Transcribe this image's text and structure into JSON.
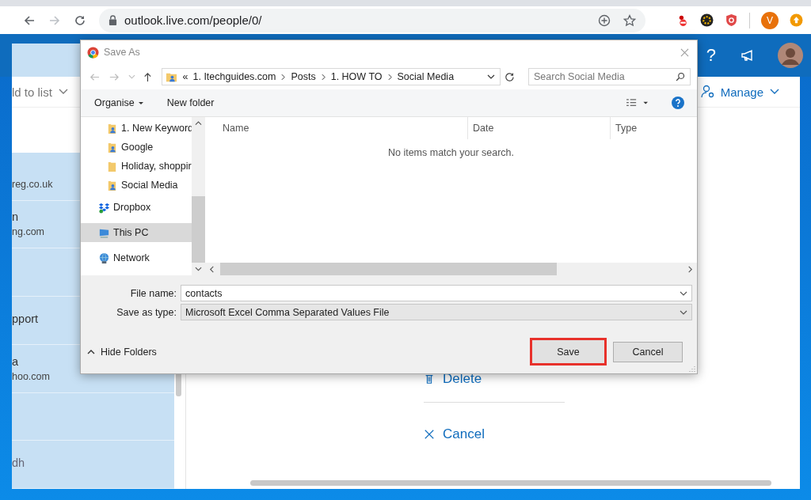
{
  "browser": {
    "url": "outlook.live.com/people/0/",
    "profile_initial": "V"
  },
  "outlook": {
    "help_glyph": "?",
    "add_to_list": "ld to list",
    "manage": "Manage",
    "contacts": [
      {
        "kind": "contact",
        "email": "reg.co.uk"
      },
      {
        "kind": "contact",
        "name": "n",
        "email": "ng.com"
      },
      {
        "kind": "blank"
      },
      {
        "kind": "contact",
        "name": "pport"
      },
      {
        "kind": "contact",
        "name": "a",
        "email": "hoo.com"
      },
      {
        "kind": "blank"
      },
      {
        "kind": "contact",
        "name": "dh"
      }
    ],
    "actions": [
      {
        "kind": "delete",
        "label": "Delete"
      },
      {
        "kind": "cancel",
        "label": "Cancel"
      }
    ]
  },
  "dialog": {
    "title": "Save As",
    "breadcrumb": {
      "overflow": "«",
      "parts": [
        "1. Itechguides.com",
        "Posts",
        "1. HOW TO",
        "Social Media"
      ]
    },
    "search": {
      "placeholder": "Search Social Media"
    },
    "organise": "Organise",
    "new_folder": "New folder",
    "folders": [
      {
        "label": "1. New Keyword",
        "kind": "user-folder",
        "selected": false
      },
      {
        "label": "Google",
        "kind": "user-folder",
        "selected": false
      },
      {
        "label": "Holiday, shoppir",
        "kind": "folder",
        "selected": false
      },
      {
        "label": "Social Media",
        "kind": "user-folder",
        "selected": false
      }
    ],
    "locations": [
      {
        "label": "Dropbox",
        "kind": "dropbox",
        "selected": false
      },
      {
        "label": "This PC",
        "kind": "pc",
        "selected": true
      },
      {
        "label": "Network",
        "kind": "network",
        "selected": false
      }
    ],
    "columns": [
      "Name",
      "Date",
      "Type"
    ],
    "empty_message": "No items match your search.",
    "file_name": {
      "label": "File name:",
      "value": "contacts"
    },
    "save_type": {
      "label": "Save as type:",
      "value": "Microsoft Excel Comma Separated Values File"
    },
    "hide_folders": "Hide Folders",
    "buttons": [
      {
        "label": "Save",
        "highlighted": true
      },
      {
        "label": "Cancel",
        "highlighted": false
      }
    ]
  }
}
